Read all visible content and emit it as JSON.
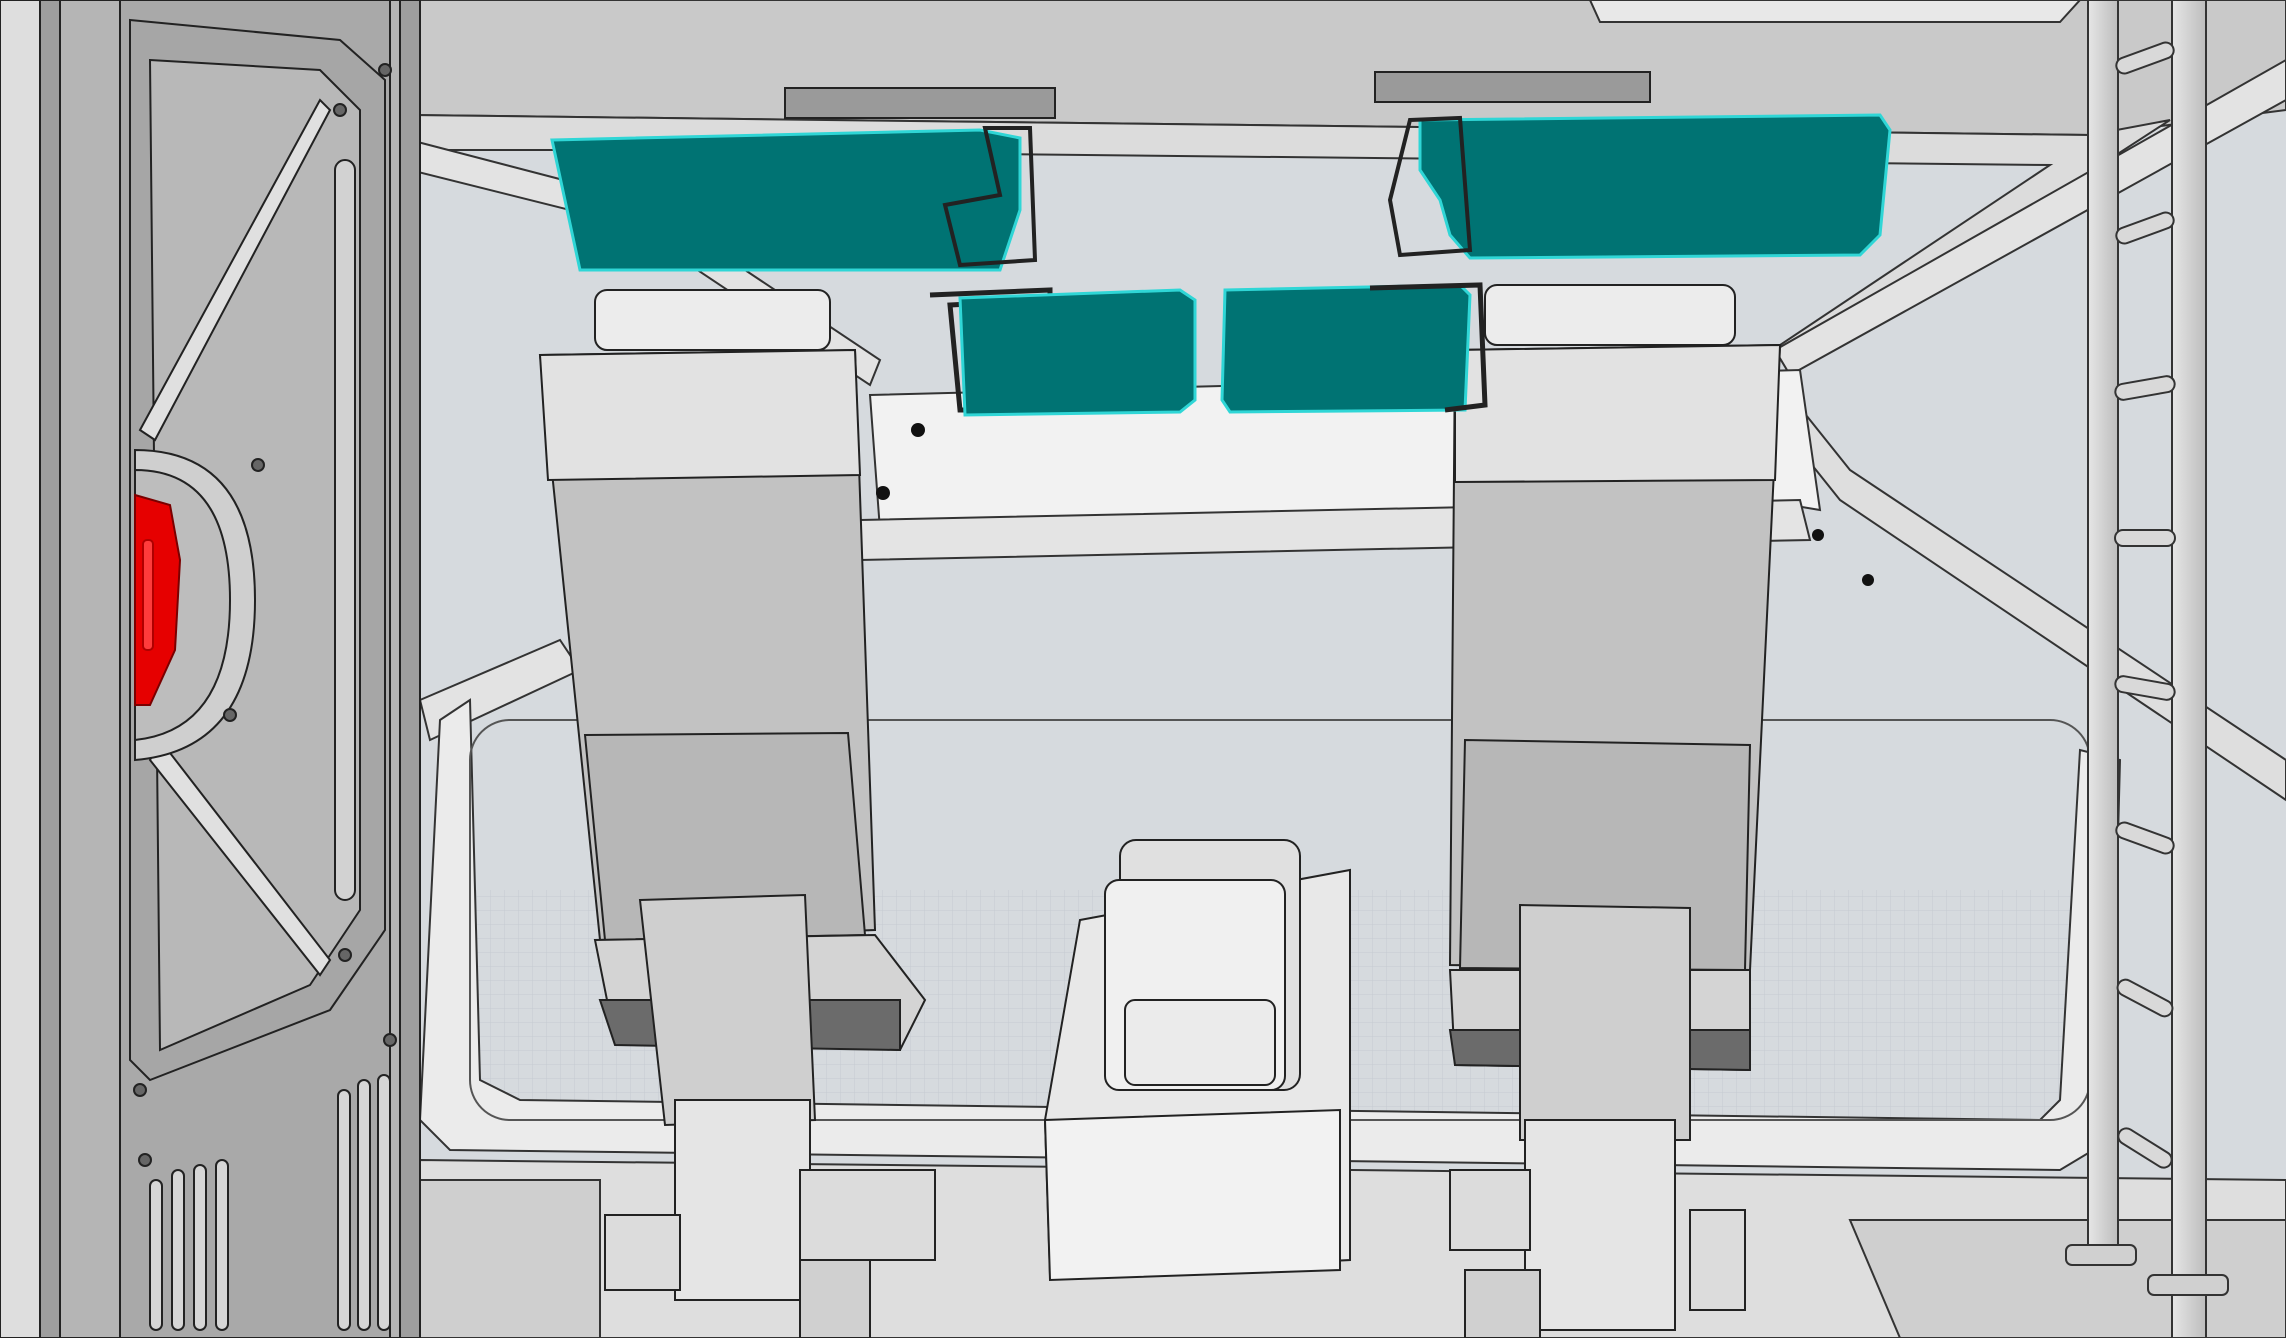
{
  "app": {
    "view_kind": "3d-cad-viewport"
  },
  "scene": {
    "background_color": "#d6dade",
    "highlight_color": "#007373",
    "highlight_outline": "#2fd6d6",
    "accent_color": "#e60000",
    "shell_color": "#c8c8c8",
    "floor_grid": "on",
    "selected_parts": [
      "sun-visor-left-upper",
      "sun-visor-left-lower",
      "sun-visor-right-upper",
      "sun-visor-right-lower"
    ],
    "visible_parts": [
      "door-panel",
      "door-handle",
      "roof-frame",
      "windshield-frame",
      "pilot-seat-left",
      "pilot-seat-right",
      "center-console",
      "ladder"
    ]
  }
}
